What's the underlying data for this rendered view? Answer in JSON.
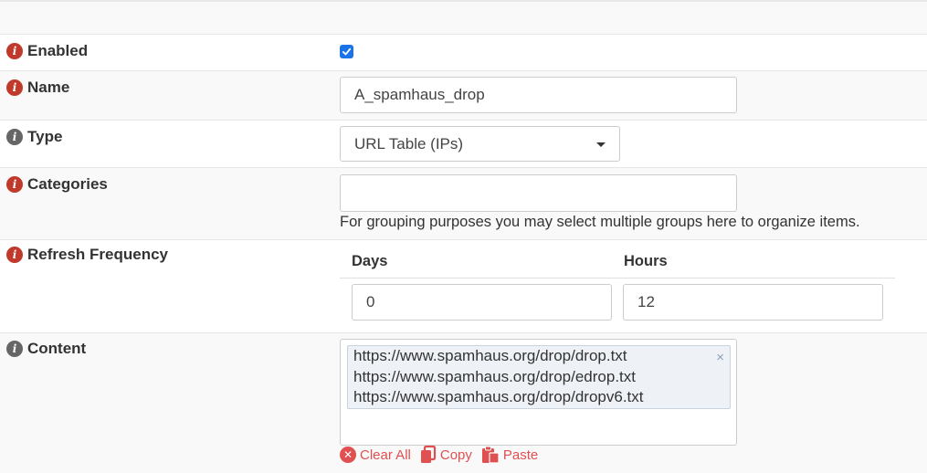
{
  "fields": {
    "enabled": {
      "label": "Enabled",
      "checked": true
    },
    "name": {
      "label": "Name",
      "value": "A_spamhaus_drop"
    },
    "type": {
      "label": "Type",
      "value": "URL Table (IPs)"
    },
    "categories": {
      "label": "Categories",
      "value": "",
      "help": "For grouping purposes you may select multiple groups here to organize items."
    },
    "refresh": {
      "label": "Refresh Frequency",
      "days_label": "Days",
      "hours_label": "Hours",
      "days_value": "0",
      "hours_value": "12"
    },
    "content": {
      "label": "Content",
      "items": [
        "https://www.spamhaus.org/drop/drop.txt",
        "https://www.spamhaus.org/drop/edrop.txt",
        "https://www.spamhaus.org/drop/dropv6.txt"
      ],
      "remove_symbol": "×",
      "actions": {
        "clear_all": "Clear All",
        "copy": "Copy",
        "paste": "Paste"
      }
    }
  },
  "icons": {
    "info": "i",
    "info_icon_colors": {
      "required": "#c0392b",
      "optional": "#666666"
    },
    "accent": "#e05050"
  }
}
